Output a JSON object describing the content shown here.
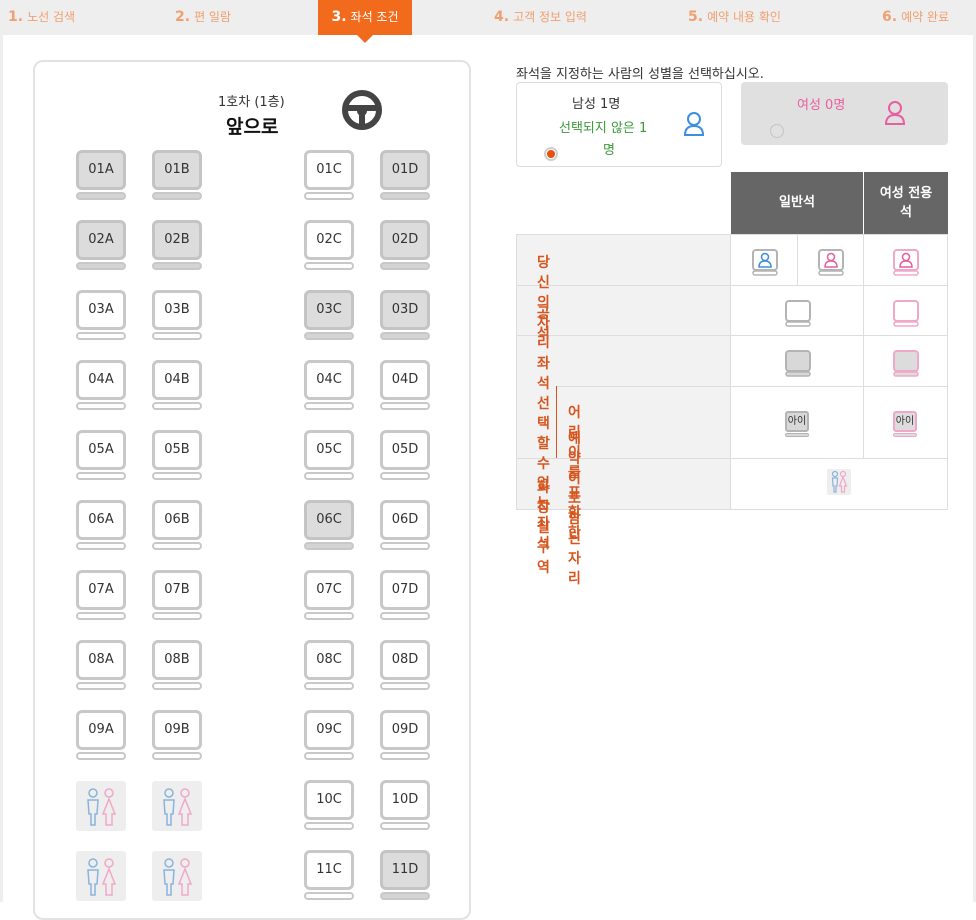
{
  "steps": [
    {
      "num": "1.",
      "label": "노선 검색"
    },
    {
      "num": "2.",
      "label": "편 일람"
    },
    {
      "num": "3.",
      "label": "좌석 조건"
    },
    {
      "num": "4.",
      "label": "고객 정보 입력"
    },
    {
      "num": "5.",
      "label": "예약 내용 확인"
    },
    {
      "num": "6.",
      "label": "예약 완료"
    }
  ],
  "car": {
    "title": "1호차 (1층)",
    "front": "앞으로"
  },
  "seats": [
    {
      "label": "01A",
      "taken": true
    },
    {
      "label": "01B",
      "taken": true
    },
    {
      "label": "01C",
      "taken": false
    },
    {
      "label": "01D",
      "taken": true
    },
    {
      "label": "02A",
      "taken": true
    },
    {
      "label": "02B",
      "taken": true
    },
    {
      "label": "02C",
      "taken": false
    },
    {
      "label": "02D",
      "taken": true
    },
    {
      "label": "03A",
      "taken": false
    },
    {
      "label": "03B",
      "taken": false
    },
    {
      "label": "03C",
      "taken": true
    },
    {
      "label": "03D",
      "taken": true
    },
    {
      "label": "04A",
      "taken": false
    },
    {
      "label": "04B",
      "taken": false
    },
    {
      "label": "04C",
      "taken": false
    },
    {
      "label": "04D",
      "taken": false
    },
    {
      "label": "05A",
      "taken": false
    },
    {
      "label": "05B",
      "taken": false
    },
    {
      "label": "05C",
      "taken": false
    },
    {
      "label": "05D",
      "taken": false
    },
    {
      "label": "06A",
      "taken": false
    },
    {
      "label": "06B",
      "taken": false
    },
    {
      "label": "06C",
      "taken": true
    },
    {
      "label": "06D",
      "taken": false
    },
    {
      "label": "07A",
      "taken": false
    },
    {
      "label": "07B",
      "taken": false
    },
    {
      "label": "07C",
      "taken": false
    },
    {
      "label": "07D",
      "taken": false
    },
    {
      "label": "08A",
      "taken": false
    },
    {
      "label": "08B",
      "taken": false
    },
    {
      "label": "08C",
      "taken": false
    },
    {
      "label": "08D",
      "taken": false
    },
    {
      "label": "09A",
      "taken": false
    },
    {
      "label": "09B",
      "taken": false
    },
    {
      "label": "09C",
      "taken": false
    },
    {
      "label": "09D",
      "taken": false
    },
    {
      "label": "",
      "toilet": true
    },
    {
      "label": "",
      "toilet": true
    },
    {
      "label": "10C",
      "taken": false
    },
    {
      "label": "10D",
      "taken": false
    },
    {
      "label": "",
      "toilet": true
    },
    {
      "label": "",
      "toilet": true
    },
    {
      "label": "11C",
      "taken": false
    },
    {
      "label": "11D",
      "taken": true
    }
  ],
  "gender": {
    "prompt": "좌석을 지정하는 사람의 성별을 선택하십시오.",
    "male": {
      "label": "남성 1명",
      "unselected_line1": "선택되지 않은 1",
      "unselected_line2": "명"
    },
    "female": {
      "label": "여성 0명"
    }
  },
  "legend": {
    "col_general": "일반석",
    "col_women_line1": "여성 전용",
    "col_women_line2": "석",
    "rows": {
      "yours": "당신의 자리",
      "vacant": "공석",
      "unavailable": "좌석 선택할 수 없는 좌석",
      "child_line1": "어린이를 포함한",
      "child_line2": "예약이 포함된 자리",
      "toilet": "화장실 구역"
    },
    "child_badge": "아이"
  },
  "colors": {
    "accent": "#f26b1d",
    "male": "#3b8ee0",
    "female": "#e65fa0",
    "label": "#d6561f"
  }
}
